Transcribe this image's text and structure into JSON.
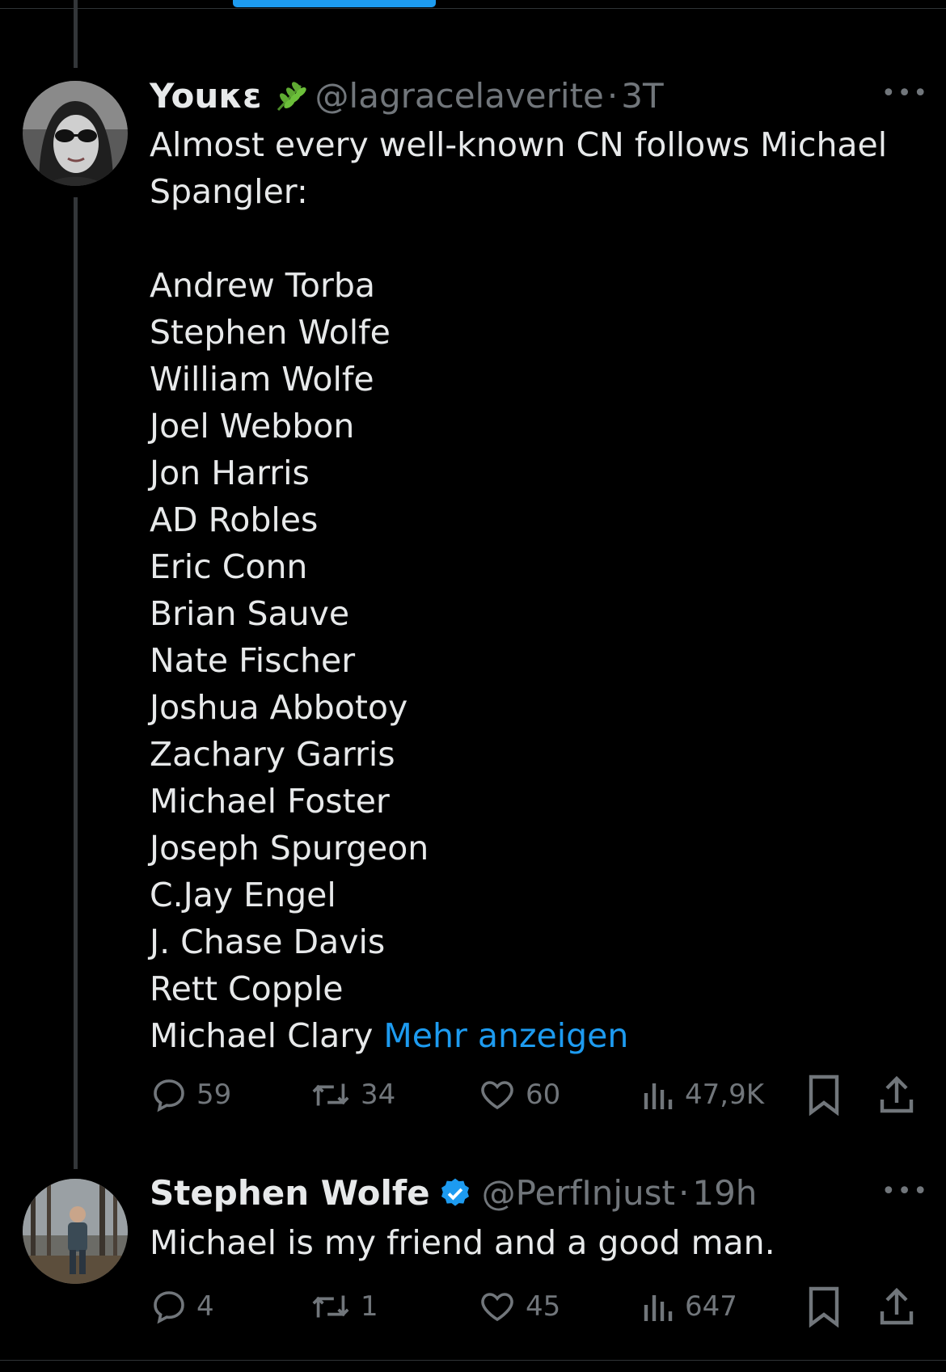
{
  "colors": {
    "background": "#000000",
    "text": "#e7e9ea",
    "muted": "#71767b",
    "accent": "#1d9bf0"
  },
  "tweets": [
    {
      "display_name": "Youκε",
      "name_emoji": "herb-icon",
      "handle": "@lagracelaverite",
      "separator": "·",
      "time": "3T",
      "text_intro": "Almost every well-known CN follows Michael\nSpangler:",
      "names": [
        "Andrew Torba",
        "Stephen Wolfe",
        "William Wolfe",
        "Joel Webbon",
        "Jon Harris",
        "AD Robles",
        "Eric Conn",
        "Brian Sauve",
        "Nate Fischer",
        "Joshua Abbotoy",
        "Zachary Garris",
        "Michael Foster",
        "Joseph Spurgeon",
        "C.Jay Engel",
        "J. Chase Davis",
        "Rett Copple"
      ],
      "last_name": "Michael Clary",
      "show_more": "Mehr anzeigen",
      "replies": "59",
      "retweets": "34",
      "likes": "60",
      "views": "47,9K"
    },
    {
      "display_name": "Stephen Wolfe",
      "verified": true,
      "handle": "@PerfInjust",
      "separator": "·",
      "time": "19h",
      "text": "Michael is my friend and a good man.",
      "replies": "4",
      "retweets": "1",
      "likes": "45",
      "views": "647"
    }
  ]
}
